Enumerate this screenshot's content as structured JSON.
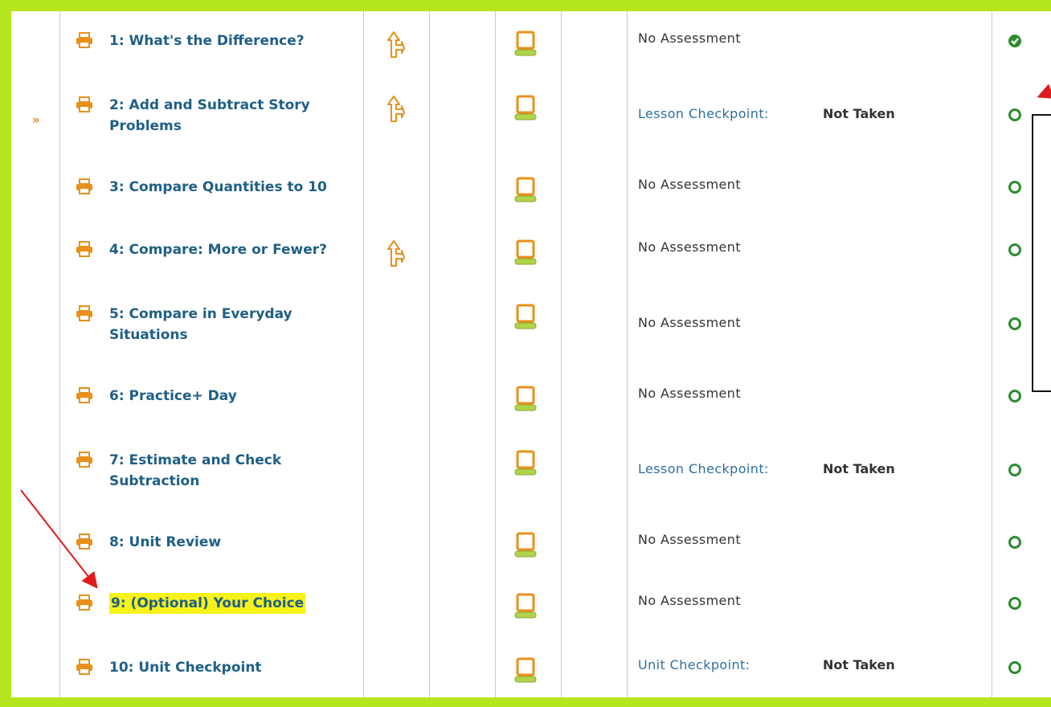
{
  "rows": [
    {
      "title": "1: What's the Difference?",
      "has_path": true,
      "assessment": "No Assessment",
      "assessment_link": false,
      "status": "",
      "complete": true,
      "current": false,
      "highlighted": false
    },
    {
      "title": "2: Add and Subtract Story Problems",
      "has_path": true,
      "assessment": "Lesson Checkpoint:",
      "assessment_link": true,
      "status": "Not Taken",
      "complete": false,
      "current": true,
      "highlighted": false
    },
    {
      "title": "3: Compare Quantities to 10",
      "has_path": false,
      "assessment": "No Assessment",
      "assessment_link": false,
      "status": "",
      "complete": false,
      "current": false,
      "highlighted": false
    },
    {
      "title": "4: Compare: More or Fewer?",
      "has_path": true,
      "assessment": "No Assessment",
      "assessment_link": false,
      "status": "",
      "complete": false,
      "current": false,
      "highlighted": false
    },
    {
      "title": "5: Compare in Everyday Situations",
      "has_path": false,
      "assessment": "No Assessment",
      "assessment_link": false,
      "status": "",
      "complete": false,
      "current": false,
      "highlighted": false
    },
    {
      "title": "6: Practice+ Day",
      "has_path": false,
      "assessment": "No Assessment",
      "assessment_link": false,
      "status": "",
      "complete": false,
      "current": false,
      "highlighted": false
    },
    {
      "title": "7: Estimate and Check Subtraction",
      "has_path": false,
      "assessment": "Lesson Checkpoint:",
      "assessment_link": true,
      "status": "Not Taken",
      "complete": false,
      "current": false,
      "highlighted": false
    },
    {
      "title": "8: Unit Review",
      "has_path": false,
      "assessment": "No Assessment",
      "assessment_link": false,
      "status": "",
      "complete": false,
      "current": false,
      "highlighted": false
    },
    {
      "title": "9: (Optional) Your Choice",
      "has_path": false,
      "assessment": "No Assessment",
      "assessment_link": false,
      "status": "",
      "complete": false,
      "current": false,
      "highlighted": true
    },
    {
      "title": "10: Unit Checkpoint",
      "has_path": false,
      "assessment": "Unit Checkpoint:",
      "assessment_link": true,
      "status": "Not Taken",
      "complete": false,
      "current": false,
      "highlighted": false
    }
  ],
  "current_marker": "»",
  "icons": {
    "print": "printer-icon",
    "path": "signpost-icon",
    "computer": "computer-icon",
    "complete": "check-circle-icon",
    "incomplete": "empty-circle-icon"
  },
  "colors": {
    "frame": "#b5e61d",
    "accent_orange": "#e8901a",
    "link_blue": "#1f5f86",
    "complete_green": "#2e8b2e",
    "highlight_yellow": "#f6f21a",
    "annotation_red": "#e01b1b"
  }
}
